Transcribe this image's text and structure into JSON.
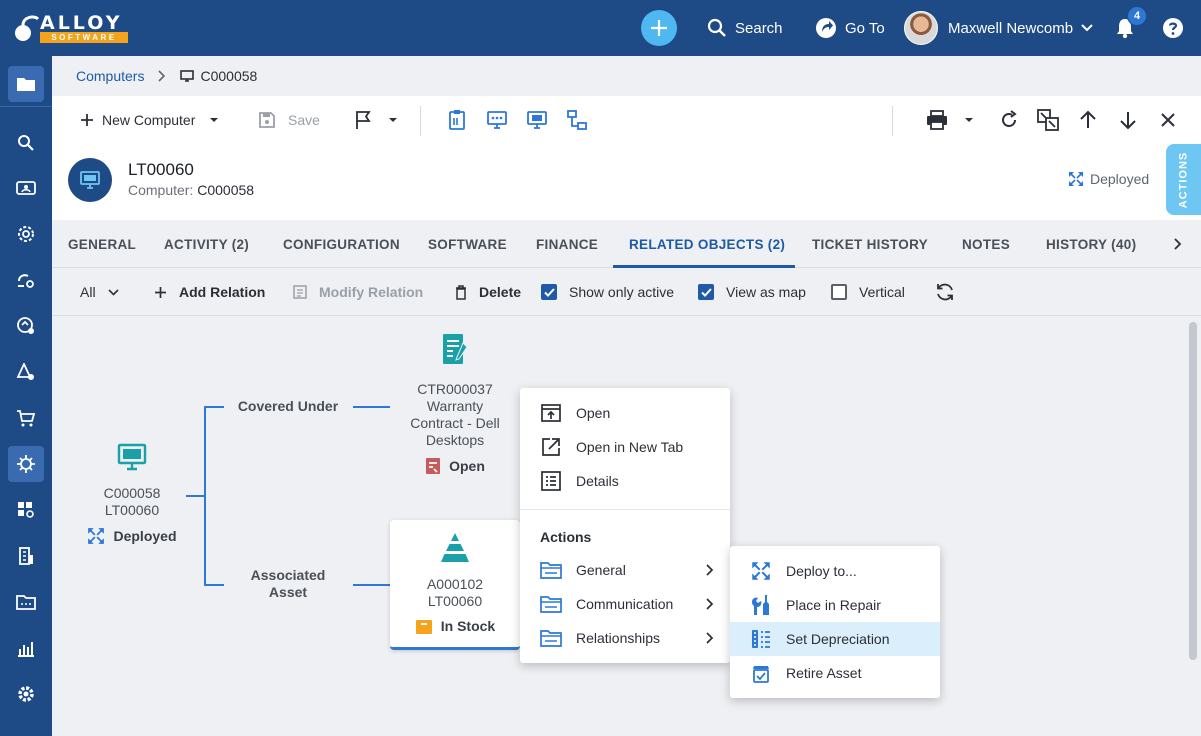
{
  "app": {
    "logo_word": "ALLOY",
    "logo_sub": "SOFTWARE",
    "search_label": "Search",
    "goto_label": "Go To",
    "user_name": "Maxwell Newcomb",
    "notification_count": "4",
    "brand_color": "#1e4a86",
    "accent_color": "#2d78d4"
  },
  "breadcrumb": {
    "root": "Computers",
    "current": "C000058"
  },
  "toolbar": {
    "new_label": "New Computer",
    "save_label": "Save"
  },
  "header": {
    "title": "LT00060",
    "sub_label": "Computer:",
    "sub_value": "C000058",
    "status": "Deployed",
    "actions_tab": "ACTIONS"
  },
  "tabs": [
    {
      "label": "GENERAL"
    },
    {
      "label": "ACTIVITY (2)"
    },
    {
      "label": "CONFIGURATION"
    },
    {
      "label": "SOFTWARE"
    },
    {
      "label": "FINANCE"
    },
    {
      "label": "RELATED OBJECTS (2)",
      "active": true
    },
    {
      "label": "TICKET HISTORY"
    },
    {
      "label": "NOTES"
    },
    {
      "label": "HISTORY (40)"
    }
  ],
  "subbar": {
    "filter": "All",
    "add_relation": "Add Relation",
    "modify_relation": "Modify Relation",
    "delete": "Delete",
    "show_only_active": "Show only active",
    "view_as_map": "View as map",
    "vertical": "Vertical",
    "show_only_active_checked": true,
    "view_as_map_checked": true,
    "vertical_checked": false
  },
  "map": {
    "root": {
      "line1": "C000058",
      "line2": "LT00060",
      "status": "Deployed"
    },
    "relations": [
      {
        "label": "Covered Under",
        "target": {
          "line1": "CTR000037",
          "line2": "Warranty",
          "line3": "Contract - Dell",
          "line4": "Desktops",
          "status": "Open"
        }
      },
      {
        "label_line1": "Associated",
        "label_line2": "Asset",
        "target": {
          "line1": "A000102",
          "line2": "LT00060",
          "status": "In Stock"
        }
      }
    ]
  },
  "context_menu": {
    "items": [
      {
        "label": "Open",
        "icon": "open-icon"
      },
      {
        "label": "Open in New Tab",
        "icon": "new-tab-icon"
      },
      {
        "label": "Details",
        "icon": "details-icon"
      }
    ],
    "actions_heading": "Actions",
    "groups": [
      {
        "label": "General",
        "icon": "folder-icon"
      },
      {
        "label": "Communication",
        "icon": "folder-icon"
      },
      {
        "label": "Relationships",
        "icon": "folder-icon"
      }
    ]
  },
  "submenu": {
    "items": [
      {
        "label": "Deploy to...",
        "icon": "deploy-icon"
      },
      {
        "label": "Place in Repair",
        "icon": "repair-icon"
      },
      {
        "label": "Set Depreciation",
        "icon": "depreciation-icon",
        "highlighted": true
      },
      {
        "label": "Retire Asset",
        "icon": "retire-icon"
      }
    ]
  }
}
